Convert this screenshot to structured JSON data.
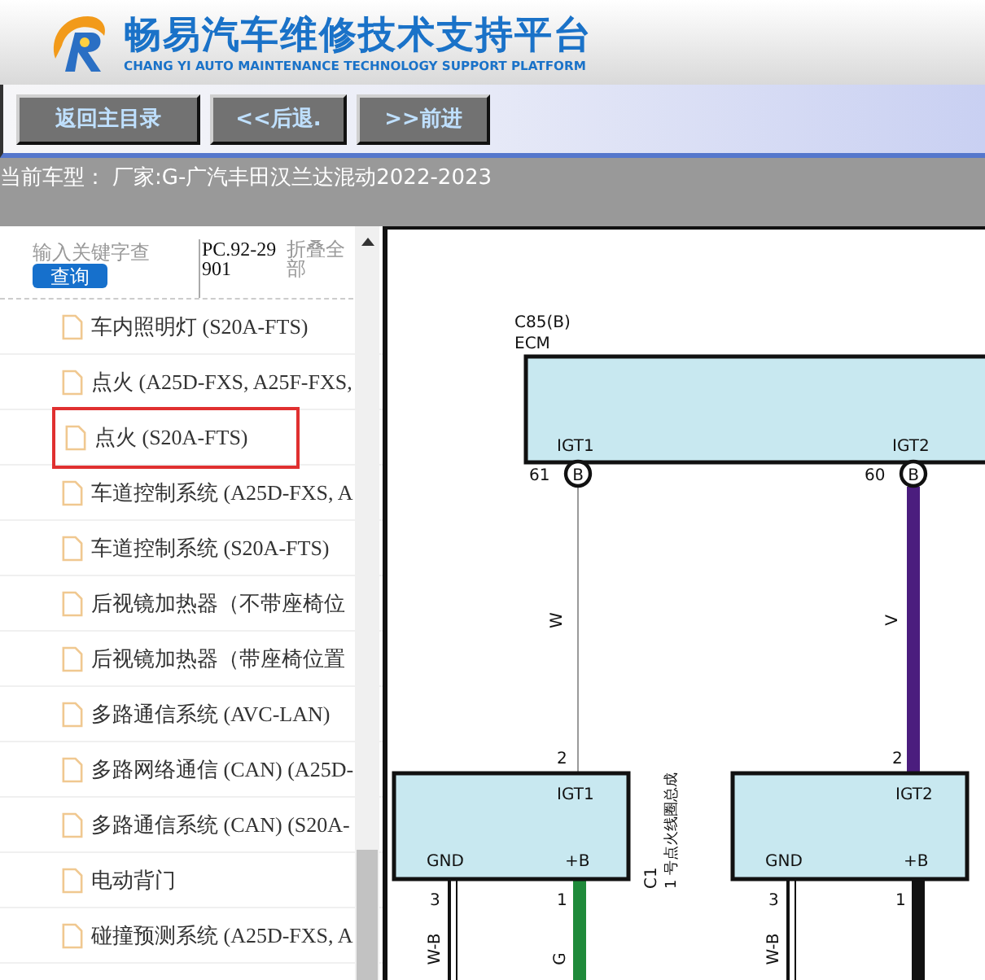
{
  "header": {
    "title": "畅易汽车维修技术支持平台",
    "subtitle": "CHANG YI AUTO MAINTENANCE TECHNOLOGY SUPPORT PLATFORM"
  },
  "nav_buttons": [
    "返回主目录",
    "<<后退.",
    ">>前进"
  ],
  "current_vehicle": {
    "label": "当前车型：",
    "value": "厂家:G-广汽丰田汉兰达混动2022-2023"
  },
  "sidebar": {
    "search": {
      "placeholder": "输入关键字查"
    },
    "search_button": "查询",
    "code": "PC.92-29901",
    "collapse_all": "折叠全部",
    "items": [
      {
        "label": "车内照明灯 (S20A-FTS)",
        "selected": false
      },
      {
        "label": "点火 (A25D-FXS, A25F-FXS,",
        "selected": false
      },
      {
        "label": "点火 (S20A-FTS)",
        "selected": true
      },
      {
        "label": "车道控制系统 (A25D-FXS, A",
        "selected": false
      },
      {
        "label": "车道控制系统 (S20A-FTS)",
        "selected": false
      },
      {
        "label": "后视镜加热器（不带座椅位",
        "selected": false
      },
      {
        "label": "后视镜加热器（带座椅位置",
        "selected": false
      },
      {
        "label": "多路通信系统 (AVC-LAN)",
        "selected": false
      },
      {
        "label": "多路网络通信 (CAN) (A25D-",
        "selected": false
      },
      {
        "label": "多路通信系统 (CAN) (S20A-",
        "selected": false
      },
      {
        "label": "电动背门",
        "selected": false
      },
      {
        "label": "碰撞预测系统 (A25D-FXS, A",
        "selected": false
      }
    ]
  },
  "diagram": {
    "ecm": {
      "connector": "C85(B)",
      "name": "ECM",
      "pins": [
        {
          "label": "IGT1",
          "number": "61",
          "tag": "B",
          "wire": "W",
          "far_pin": "2"
        },
        {
          "label": "IGT2",
          "number": "60",
          "tag": "B",
          "wire": "V",
          "far_pin": "2"
        }
      ]
    },
    "coils": [
      {
        "signal": "IGT1",
        "gnd": "GND",
        "power": "+B",
        "gnd_pin": "3",
        "power_pin": "1",
        "power_wire": "G",
        "gnd_wire": "W-B",
        "connector": "C1",
        "name": "1 号点火线圈总成"
      },
      {
        "signal": "IGT2",
        "gnd": "GND",
        "power": "+B",
        "gnd_pin": "3",
        "power_pin": "1",
        "gnd_wire": "W-B"
      }
    ]
  }
}
